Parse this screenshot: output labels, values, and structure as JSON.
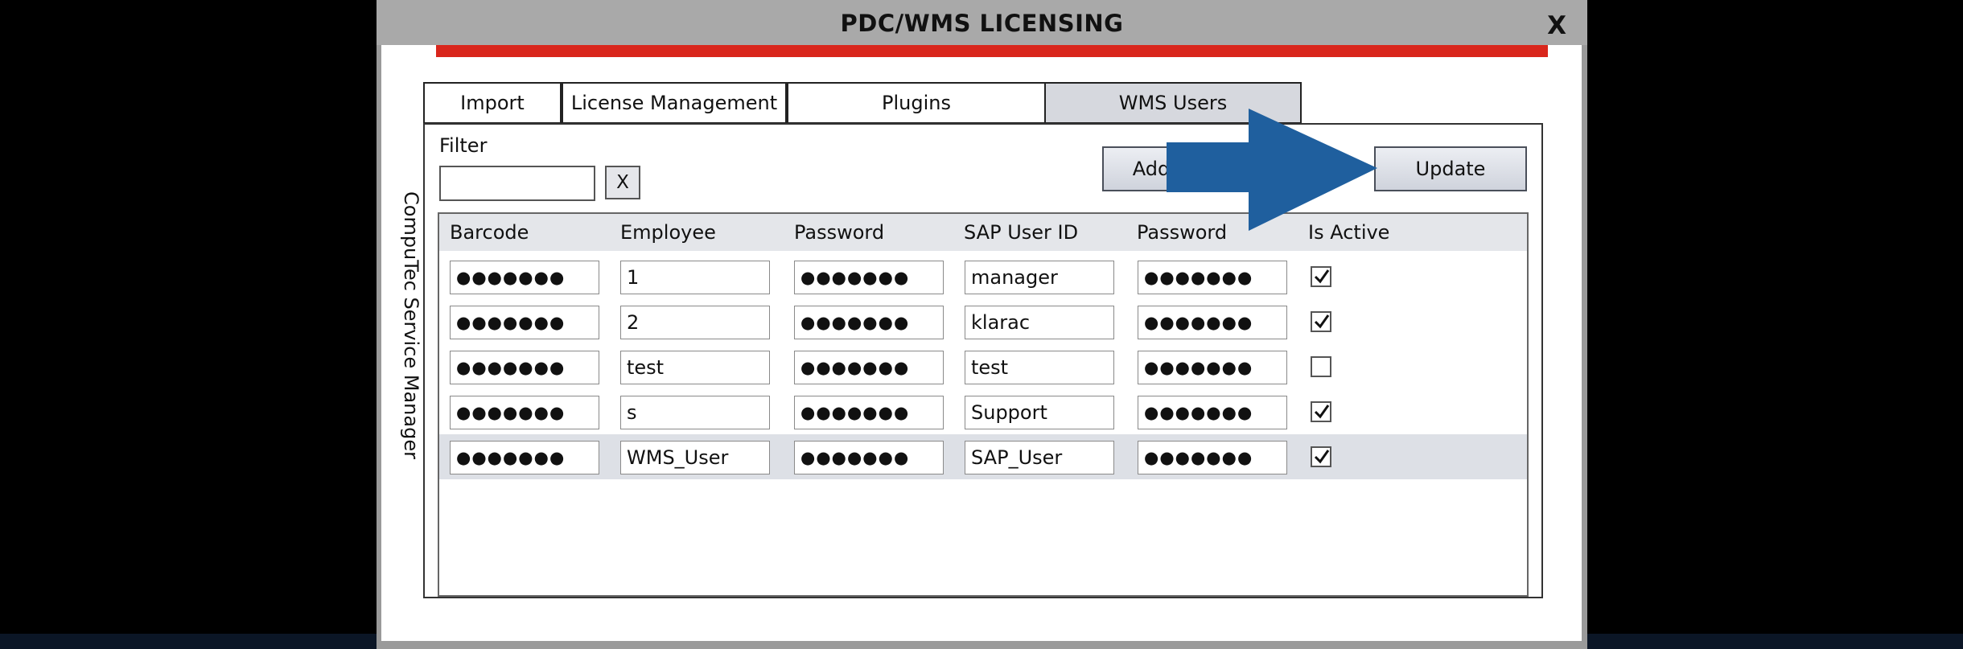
{
  "dialog": {
    "title": "PDC/WMS LICENSING",
    "close_label": "X",
    "side_label": "CompuTec Service Manager"
  },
  "tabs": [
    {
      "label": "Import"
    },
    {
      "label": "License Management"
    },
    {
      "label": "Plugins"
    },
    {
      "label": "WMS Users",
      "active": true
    }
  ],
  "filter": {
    "label": "Filter",
    "value": "",
    "clear_label": "X"
  },
  "toolbar": {
    "add_label": "Add",
    "update_label": "Update"
  },
  "table": {
    "columns": [
      "Barcode",
      "Employee",
      "Password",
      "SAP User ID",
      "Password",
      "Is Active"
    ],
    "rows": [
      {
        "barcode": "●●●●●●●",
        "employee": "1",
        "password": "●●●●●●●",
        "sap_user_id": "manager",
        "sap_password": "●●●●●●●",
        "is_active": true
      },
      {
        "barcode": "●●●●●●●",
        "employee": "2",
        "password": "●●●●●●●",
        "sap_user_id": "klarac",
        "sap_password": "●●●●●●●",
        "is_active": true
      },
      {
        "barcode": "●●●●●●●",
        "employee": "test",
        "password": "●●●●●●●",
        "sap_user_id": "test",
        "sap_password": "●●●●●●●",
        "is_active": false
      },
      {
        "barcode": "●●●●●●●",
        "employee": "s",
        "password": "●●●●●●●",
        "sap_user_id": "Support",
        "sap_password": "●●●●●●●",
        "is_active": true
      },
      {
        "barcode": "●●●●●●●",
        "employee": "WMS_User",
        "password": "●●●●●●●",
        "sap_user_id": "SAP_User",
        "sap_password": "●●●●●●●",
        "is_active": true,
        "selected": true
      }
    ]
  },
  "colors": {
    "accent_red": "#d9261c",
    "arrow_blue": "#1f5f9e",
    "title_bar": "#a9a9a9"
  },
  "icons": {
    "pointer": "arrow-right-icon",
    "check": "checkmark-icon"
  }
}
